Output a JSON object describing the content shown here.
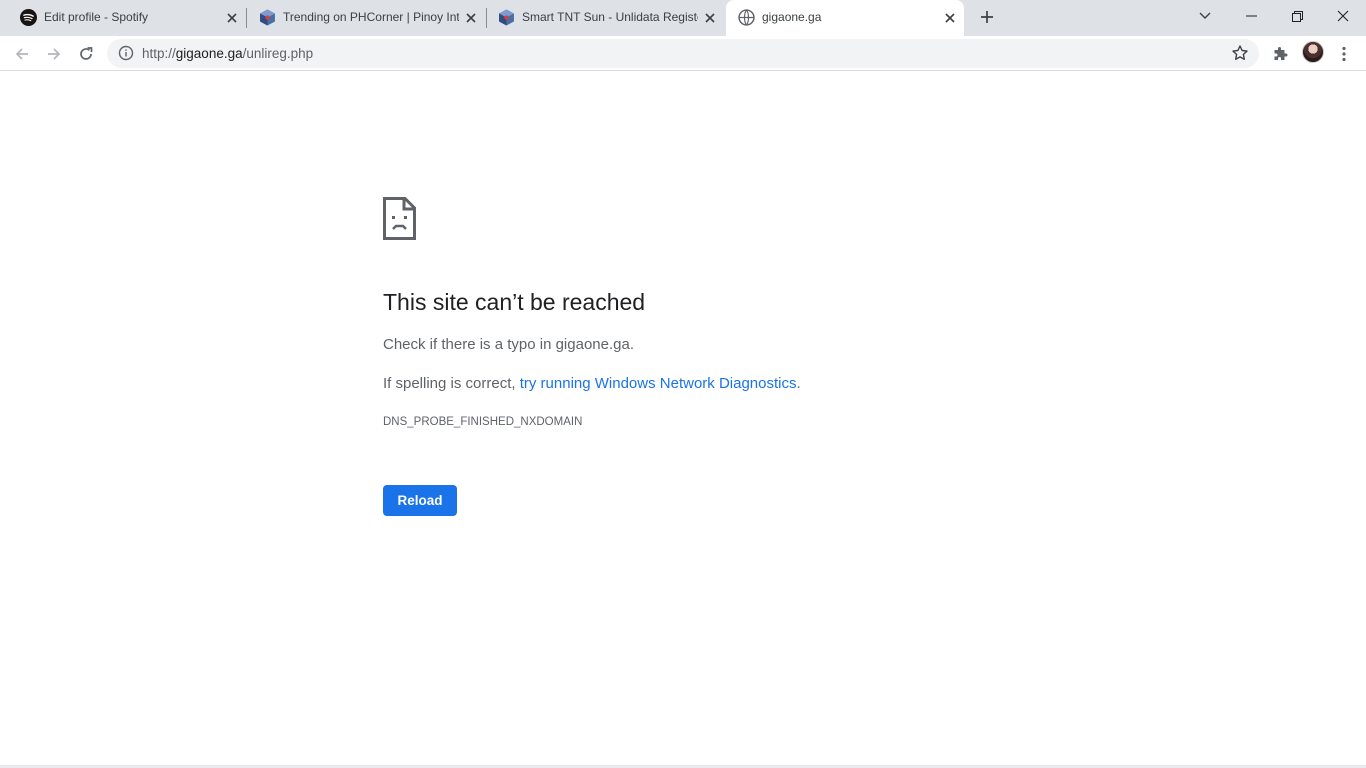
{
  "tabs": [
    {
      "title": "Edit profile - Spotify",
      "icon": "spotify-icon"
    },
    {
      "title": "Trending on PHCorner | Pinoy Int",
      "icon": "phcorner-icon"
    },
    {
      "title": "Smart TNT Sun - Unlidata Registe",
      "icon": "phcorner-icon"
    },
    {
      "title": "gigaone.ga",
      "icon": "globe-icon",
      "active": true
    }
  ],
  "address_bar": {
    "scheme": "http://",
    "host": "gigaone.ga",
    "path": "/unlireg.php"
  },
  "error_page": {
    "heading": "This site can’t be reached",
    "line1": "Check if there is a typo in gigaone.ga.",
    "line2_prefix": "If spelling is correct, ",
    "line2_link": "try running Windows Network Diagnostics",
    "line2_suffix": ".",
    "error_code": "DNS_PROBE_FINISHED_NXDOMAIN",
    "reload_label": "Reload"
  },
  "colors": {
    "tabstrip": "#dee1e6",
    "accent": "#1a73e8",
    "link": "#1a73e8",
    "text_primary": "#202124",
    "text_secondary": "#5f6368"
  }
}
